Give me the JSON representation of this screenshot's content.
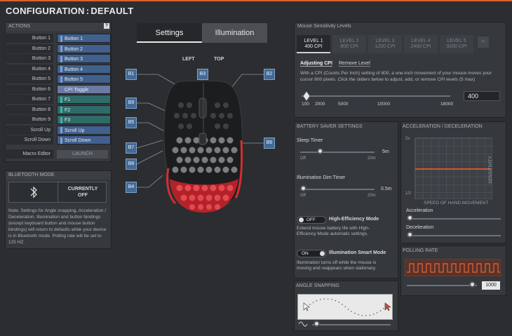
{
  "title": {
    "config": "CONFIGURATION",
    "profile": "DEFAULT"
  },
  "actions": {
    "header": "ACTIONS",
    "rows": [
      {
        "label": "Button 1",
        "value": "Button 1",
        "style": "blue"
      },
      {
        "label": "Button 2",
        "value": "Button 2",
        "style": "blue"
      },
      {
        "label": "Button 3",
        "value": "Button 3",
        "style": "blue"
      },
      {
        "label": "Button 4",
        "value": "Button 4",
        "style": "blue"
      },
      {
        "label": "Button 5",
        "value": "Button 5",
        "style": "blue"
      },
      {
        "label": "Button 6",
        "value": "CPI Toggle",
        "style": "lav"
      },
      {
        "label": "Button 7",
        "value": "F1",
        "style": "teal"
      },
      {
        "label": "Button 8",
        "value": "F2",
        "style": "teal"
      },
      {
        "label": "Button 9",
        "value": "F3",
        "style": "teal"
      },
      {
        "label": "Scroll Up",
        "value": "Scroll Up",
        "style": "blue"
      },
      {
        "label": "Scroll Down",
        "value": "Scroll Down",
        "style": "blue"
      }
    ],
    "macro_label": "Macro Editor",
    "launch": "LAUNCH"
  },
  "bluetooth": {
    "header": "BLUETOOTH MODE",
    "status_line1": "CURRENTLY",
    "status_line2": "OFF",
    "note": "Note: Settings for Angle snapping, Acceleration / Deceleration, Illumination and button bindings (except keyboard button and mouse button bindings) will return to defaults while your device is in Bluetooth mode. Polling rate will be set to 125 HZ."
  },
  "tabs": {
    "settings": "Settings",
    "illumination": "Illumination"
  },
  "mouse": {
    "left": "LEFT",
    "top": "TOP",
    "buttons": {
      "b1": "B1",
      "b2": "B2",
      "b3": "B3",
      "b4": "B4",
      "b5": "B5",
      "b6": "B6",
      "b7": "B7",
      "b8": "B8",
      "b9": "B9"
    }
  },
  "sensitivity": {
    "header": "Mouse Sensitivity Levels",
    "levels": [
      {
        "name": "LEVEL 1",
        "cpi": "400 CPI"
      },
      {
        "name": "LEVEL 2",
        "cpi": "800 CPI"
      },
      {
        "name": "LEVEL 3",
        "cpi": "1200 CPI"
      },
      {
        "name": "LEVEL 4",
        "cpi": "2400 CPI"
      },
      {
        "name": "LEVEL 5",
        "cpi": "3200 CPI"
      }
    ],
    "add": "+",
    "sub_adjusting": "Adjusting CPI",
    "sub_remove": "Remove Level",
    "description": "With a CPI (Counts Per Inch) setting of 800, a one-inch movement of your mouse moves your cursor 800 pixels. Click the sliders below to adjust, add, or remove CPI levels (5 max)",
    "ticks": [
      "100",
      "2000",
      "5000",
      "10000",
      "18000"
    ],
    "value": "400"
  },
  "battery": {
    "header": "BATTERY SAVER SETTINGS",
    "sleep_label": "Sleep Timer",
    "sleep_min": "Off",
    "sleep_max": "20m",
    "sleep_value": "5m",
    "dim_label": "Illumination Dim Timer",
    "dim_min": "Off",
    "dim_max": "20m",
    "dim_value": "0.5m",
    "hem_toggle": "OFF",
    "hem_label": "High-Efficiency Mode",
    "hem_desc": "Extend mouse battery life with High-Efficiency Mode automatic settings.",
    "ism_toggle": "ON",
    "ism_label": "Illumination Smart Mode",
    "ism_desc": "Illumination turns off while the mouse is moving and reappears when stationary."
  },
  "accel": {
    "header": "ACCELERATION / DECELERATION",
    "y_top": "2x",
    "y_bottom": "1/2",
    "y_label": "SENSITIVITY",
    "x_label": "SPEED OF HAND MOVEMENT",
    "acc_label": "Acceleration",
    "dec_label": "Deceleration"
  },
  "polling": {
    "header": "POLLING RATE",
    "value": "1000"
  },
  "angle": {
    "header": "ANGLE SNAPPING"
  }
}
